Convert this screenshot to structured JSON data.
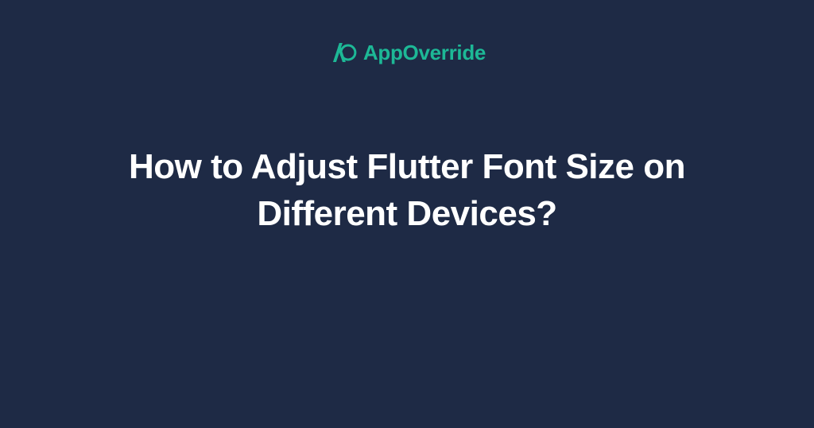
{
  "brand": {
    "name": "AppOverride",
    "accent_color": "#1db896"
  },
  "headline": "How to Adjust Flutter Font Size on Different Devices?"
}
